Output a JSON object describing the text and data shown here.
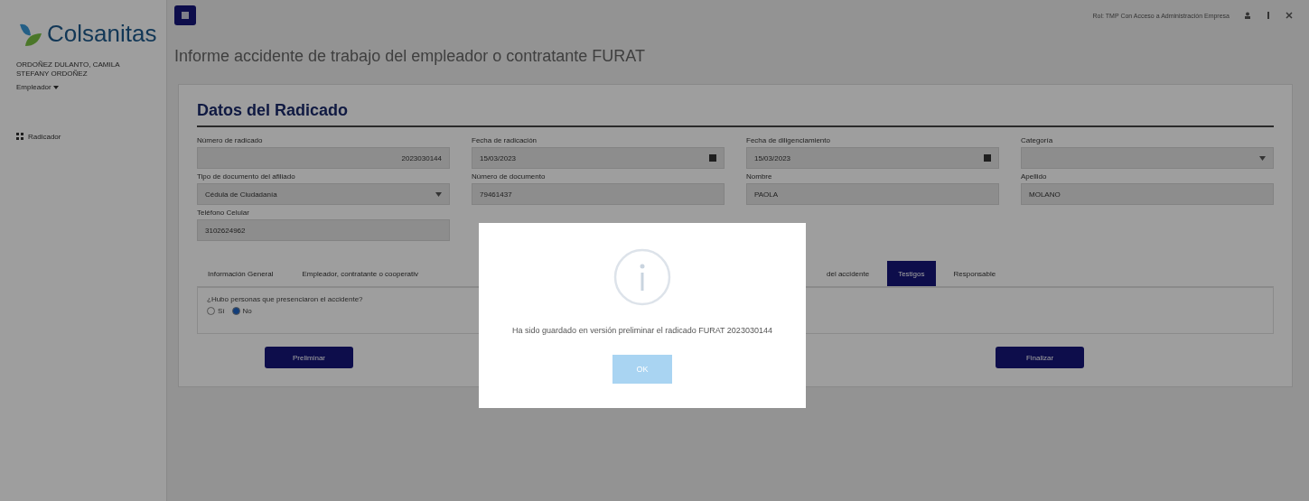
{
  "sidebar": {
    "logo_text": "Colsanitas",
    "user_name": "ORDOÑEZ DULANTO, CAMILA STEFANY ORDOÑEZ",
    "role": "Empleador",
    "items": [
      {
        "label": "Radicador",
        "selected": false
      }
    ]
  },
  "topbar": {
    "user_info": "Rol: TMP Con Acceso a Administración Empresa"
  },
  "page_title": "Informe accidente de trabajo del empleador o contratante FURAT",
  "section_title": "Datos del Radicado",
  "fields": [
    {
      "label": "Número de radicado",
      "value": "2023030144",
      "kind": "number"
    },
    {
      "label": "Fecha de radicación",
      "value": "15/03/2023",
      "kind": "date"
    },
    {
      "label": "Fecha de diligenciamiento",
      "value": "15/03/2023",
      "kind": "date"
    },
    {
      "label": "Categoría",
      "kind": "select"
    },
    {
      "label": "Tipo de documento del afiliado",
      "value": "Cédula de Ciudadanía",
      "kind": "select"
    },
    {
      "label": "Número de documento",
      "value": "79461437",
      "kind": "text"
    },
    {
      "label": "Nombre",
      "value": "PAOLA",
      "kind": "text"
    },
    {
      "label": "Apellido",
      "value": "MOLANO",
      "kind": "text"
    },
    {
      "label": "Teléfono Celular",
      "value": "3102624962",
      "kind": "text"
    }
  ],
  "tabs": [
    {
      "label": "Información General",
      "selected": false
    },
    {
      "label": "Empleador, contratante o cooperativ",
      "selected": false
    },
    {
      "label": "del accidente",
      "selected": false
    },
    {
      "label": "Testigos",
      "selected": true
    },
    {
      "label": "Responsable",
      "selected": false
    }
  ],
  "question": {
    "text": "¿Hubo personas que presenciaron el accidente?",
    "options": [
      {
        "label": "Sí",
        "selected": false
      },
      {
        "label": "No",
        "selected": true
      }
    ]
  },
  "buttons": [
    {
      "label": "Preliminar"
    },
    {
      "label": "Finalizar"
    }
  ],
  "dialog": {
    "message": "Ha sido guardado en versión preliminar el radicado FURAT 2023030144",
    "button": "OK"
  }
}
